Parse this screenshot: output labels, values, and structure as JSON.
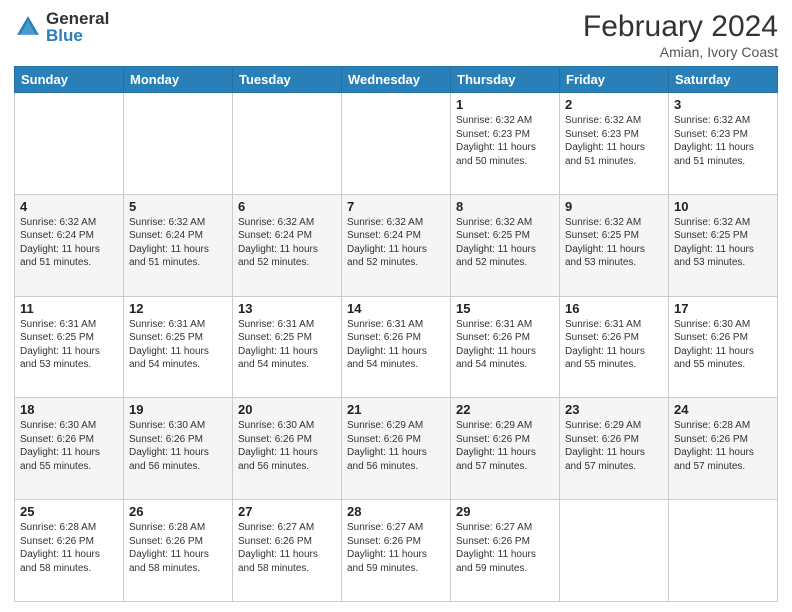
{
  "header": {
    "logo_general": "General",
    "logo_blue": "Blue",
    "month_year": "February 2024",
    "location": "Amian, Ivory Coast"
  },
  "days_of_week": [
    "Sunday",
    "Monday",
    "Tuesday",
    "Wednesday",
    "Thursday",
    "Friday",
    "Saturday"
  ],
  "weeks": [
    [
      {
        "num": "",
        "info": ""
      },
      {
        "num": "",
        "info": ""
      },
      {
        "num": "",
        "info": ""
      },
      {
        "num": "",
        "info": ""
      },
      {
        "num": "1",
        "info": "Sunrise: 6:32 AM\nSunset: 6:23 PM\nDaylight: 11 hours and 50 minutes."
      },
      {
        "num": "2",
        "info": "Sunrise: 6:32 AM\nSunset: 6:23 PM\nDaylight: 11 hours and 51 minutes."
      },
      {
        "num": "3",
        "info": "Sunrise: 6:32 AM\nSunset: 6:23 PM\nDaylight: 11 hours and 51 minutes."
      }
    ],
    [
      {
        "num": "4",
        "info": "Sunrise: 6:32 AM\nSunset: 6:24 PM\nDaylight: 11 hours and 51 minutes."
      },
      {
        "num": "5",
        "info": "Sunrise: 6:32 AM\nSunset: 6:24 PM\nDaylight: 11 hours and 51 minutes."
      },
      {
        "num": "6",
        "info": "Sunrise: 6:32 AM\nSunset: 6:24 PM\nDaylight: 11 hours and 52 minutes."
      },
      {
        "num": "7",
        "info": "Sunrise: 6:32 AM\nSunset: 6:24 PM\nDaylight: 11 hours and 52 minutes."
      },
      {
        "num": "8",
        "info": "Sunrise: 6:32 AM\nSunset: 6:25 PM\nDaylight: 11 hours and 52 minutes."
      },
      {
        "num": "9",
        "info": "Sunrise: 6:32 AM\nSunset: 6:25 PM\nDaylight: 11 hours and 53 minutes."
      },
      {
        "num": "10",
        "info": "Sunrise: 6:32 AM\nSunset: 6:25 PM\nDaylight: 11 hours and 53 minutes."
      }
    ],
    [
      {
        "num": "11",
        "info": "Sunrise: 6:31 AM\nSunset: 6:25 PM\nDaylight: 11 hours and 53 minutes."
      },
      {
        "num": "12",
        "info": "Sunrise: 6:31 AM\nSunset: 6:25 PM\nDaylight: 11 hours and 54 minutes."
      },
      {
        "num": "13",
        "info": "Sunrise: 6:31 AM\nSunset: 6:25 PM\nDaylight: 11 hours and 54 minutes."
      },
      {
        "num": "14",
        "info": "Sunrise: 6:31 AM\nSunset: 6:26 PM\nDaylight: 11 hours and 54 minutes."
      },
      {
        "num": "15",
        "info": "Sunrise: 6:31 AM\nSunset: 6:26 PM\nDaylight: 11 hours and 54 minutes."
      },
      {
        "num": "16",
        "info": "Sunrise: 6:31 AM\nSunset: 6:26 PM\nDaylight: 11 hours and 55 minutes."
      },
      {
        "num": "17",
        "info": "Sunrise: 6:30 AM\nSunset: 6:26 PM\nDaylight: 11 hours and 55 minutes."
      }
    ],
    [
      {
        "num": "18",
        "info": "Sunrise: 6:30 AM\nSunset: 6:26 PM\nDaylight: 11 hours and 55 minutes."
      },
      {
        "num": "19",
        "info": "Sunrise: 6:30 AM\nSunset: 6:26 PM\nDaylight: 11 hours and 56 minutes."
      },
      {
        "num": "20",
        "info": "Sunrise: 6:30 AM\nSunset: 6:26 PM\nDaylight: 11 hours and 56 minutes."
      },
      {
        "num": "21",
        "info": "Sunrise: 6:29 AM\nSunset: 6:26 PM\nDaylight: 11 hours and 56 minutes."
      },
      {
        "num": "22",
        "info": "Sunrise: 6:29 AM\nSunset: 6:26 PM\nDaylight: 11 hours and 57 minutes."
      },
      {
        "num": "23",
        "info": "Sunrise: 6:29 AM\nSunset: 6:26 PM\nDaylight: 11 hours and 57 minutes."
      },
      {
        "num": "24",
        "info": "Sunrise: 6:28 AM\nSunset: 6:26 PM\nDaylight: 11 hours and 57 minutes."
      }
    ],
    [
      {
        "num": "25",
        "info": "Sunrise: 6:28 AM\nSunset: 6:26 PM\nDaylight: 11 hours and 58 minutes."
      },
      {
        "num": "26",
        "info": "Sunrise: 6:28 AM\nSunset: 6:26 PM\nDaylight: 11 hours and 58 minutes."
      },
      {
        "num": "27",
        "info": "Sunrise: 6:27 AM\nSunset: 6:26 PM\nDaylight: 11 hours and 58 minutes."
      },
      {
        "num": "28",
        "info": "Sunrise: 6:27 AM\nSunset: 6:26 PM\nDaylight: 11 hours and 59 minutes."
      },
      {
        "num": "29",
        "info": "Sunrise: 6:27 AM\nSunset: 6:26 PM\nDaylight: 11 hours and 59 minutes."
      },
      {
        "num": "",
        "info": ""
      },
      {
        "num": "",
        "info": ""
      }
    ]
  ]
}
